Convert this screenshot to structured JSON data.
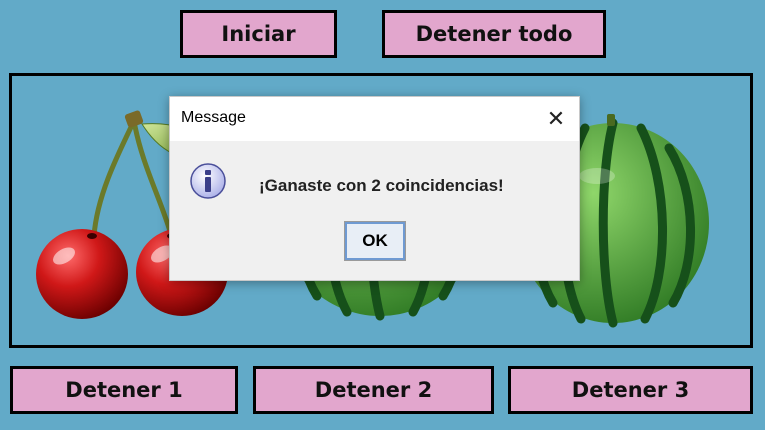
{
  "controls": {
    "start_label": "Iniciar",
    "stop_all_label": "Detener todo",
    "stop_1_label": "Detener 1",
    "stop_2_label": "Detener 2",
    "stop_3_label": "Detener 3"
  },
  "reels": [
    {
      "symbol": "cherries-icon"
    },
    {
      "symbol": "watermelon-icon"
    },
    {
      "symbol": "watermelon-icon"
    }
  ],
  "dialog": {
    "title": "Message",
    "message": "¡Ganaste con 2 coincidencias!",
    "ok_label": "OK",
    "icon": "info-icon"
  },
  "colors": {
    "background": "#62aac8",
    "button_fill": "#e2a6cd",
    "border": "#000000"
  }
}
